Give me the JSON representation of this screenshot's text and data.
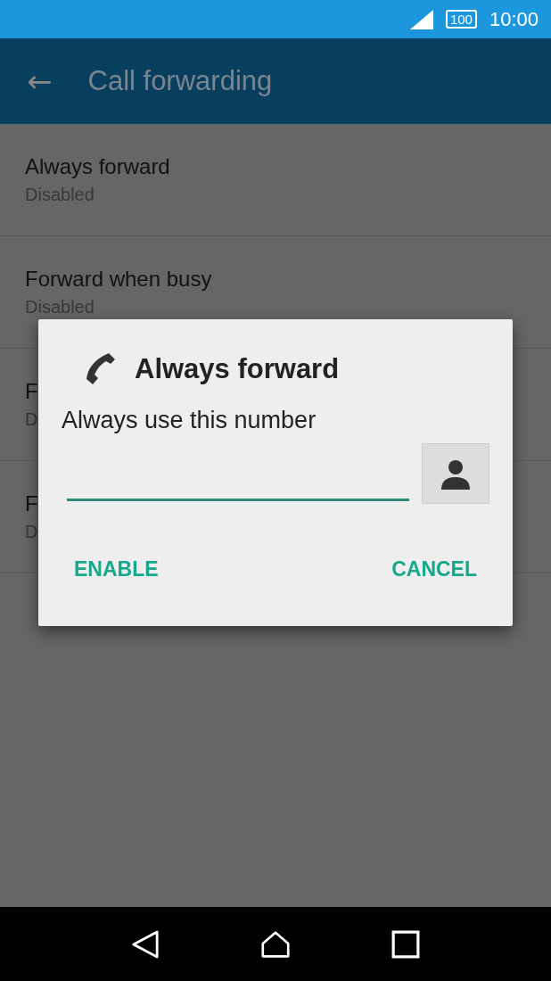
{
  "status_bar": {
    "battery": "100",
    "time": "10:00"
  },
  "app_bar": {
    "back": "←",
    "title": "Call forwarding"
  },
  "settings": [
    {
      "title": "Always forward",
      "summary": "Disabled"
    },
    {
      "title": "Forward when busy",
      "summary": "Disabled"
    },
    {
      "title": "F",
      "summary": "D"
    },
    {
      "title": "F",
      "summary": "D"
    }
  ],
  "dialog": {
    "title": "Always forward",
    "label": "Always use this number",
    "input": {
      "focused": true
    },
    "buttons": [
      "ENABLE",
      "CANCEL"
    ]
  }
}
